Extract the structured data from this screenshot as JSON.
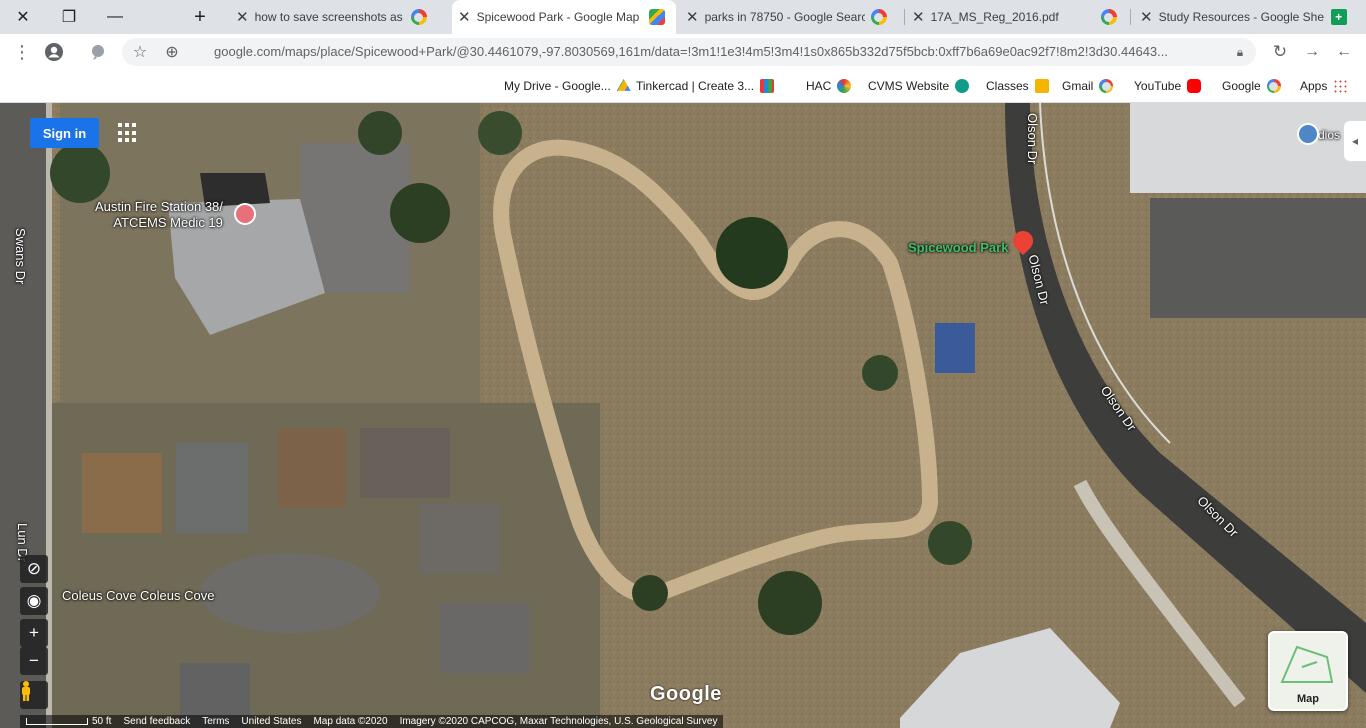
{
  "browser": {
    "tabs": [
      {
        "title": "Study Resources - Google She",
        "icon": "sheets-icon"
      },
      {
        "title": "17A_MS_Reg_2016.pdf",
        "icon": "google-icon"
      },
      {
        "title": "parks in 78750 - Google Searc",
        "icon": "google-icon"
      },
      {
        "title": "Spicewood Park - Google Map",
        "icon": "maps-icon"
      },
      {
        "title": "how to save screenshots as jp",
        "icon": "google-icon"
      }
    ],
    "url": "google.com/maps/place/Spicewood+Park/@30.4461079,-97.8030569,161m/data=!3m1!1e3!4m5!3m4!1s0x865b332d75f5bcb:0xff7b6a69e0ac92f7!8m2!3d30.44643..."
  },
  "bookmarks": [
    {
      "label": "Apps",
      "icon": "apps-icon"
    },
    {
      "label": "Google",
      "icon": "google-icon"
    },
    {
      "label": "YouTube",
      "icon": "youtube-icon"
    },
    {
      "label": "Gmail",
      "icon": "gmail-icon"
    },
    {
      "label": "Classes",
      "icon": "classroom-icon"
    },
    {
      "label": "CVMS Website",
      "icon": "cvms-icon"
    },
    {
      "label": "HAC",
      "icon": "hac-icon"
    },
    {
      "label": "Tinkercad | Create 3...",
      "icon": "tinkercad-icon"
    },
    {
      "label": "My Drive - Google...",
      "icon": "drive-icon"
    }
  ],
  "map": {
    "sign_in": "Sign in",
    "labels": {
      "park": "Spicewood Park",
      "fire_station_1": "Austin Fire Station 38/",
      "fire_station_2": "ATCEMS Medic 19",
      "street_olson_1": "Olson Dr",
      "street_olson_2": "Olson Dr",
      "street_olson_3": "Olson Dr",
      "street_olson_4": "Olson Dr",
      "street_swans": "Swans Dr",
      "street_coleus": "Coleus Cove Coleus Cove",
      "street_lun": "Lun Dr",
      "studios": "dios"
    },
    "minimap_label": "Map",
    "google_logo": "Google",
    "scale": "50 ft",
    "footer": [
      "Send feedback",
      "Terms",
      "United States",
      "Map data ©2020",
      "Imagery ©2020 CAPCOG, Maxar Technologies, U.S. Geological Survey"
    ]
  }
}
